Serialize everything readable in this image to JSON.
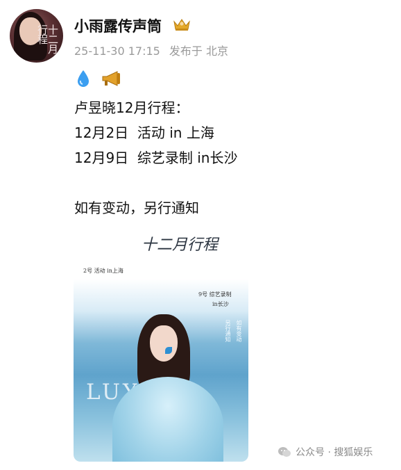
{
  "header": {
    "username": "小雨露传声筒",
    "date": "25-11-30 17:15",
    "posted_from": "发布于 北京",
    "avatar_text": "十二月行程"
  },
  "post": {
    "emojis": [
      "droplet-icon",
      "megaphone-icon"
    ],
    "lines": [
      "卢昱晓12月行程：",
      "12月2日  活动 in 上海",
      "12月9日  综艺录制 in长沙",
      "如有变动，另行通知"
    ]
  },
  "poster": {
    "calligraphy": "十二月行程",
    "left_note": "2号  活动  in上海",
    "right_note_1": "9号  综艺录制",
    "right_note_2": "in长沙",
    "side_1": "如有变动",
    "side_2": "另行通知",
    "brand": "LUY  AO"
  },
  "watermark": {
    "text": "公众号 · 搜狐娱乐"
  },
  "colors": {
    "meta_gray": "#9a9a9a",
    "poster_blue": "#5fa3cc",
    "crown_gold": "#e4a92a"
  }
}
